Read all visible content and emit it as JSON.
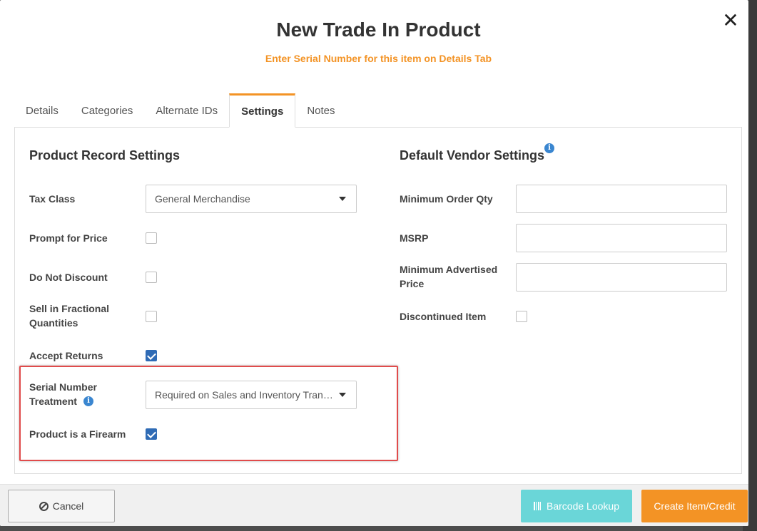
{
  "modal": {
    "title": "New Trade In Product",
    "subtitle": "Enter Serial Number for this item on Details Tab"
  },
  "tabs": [
    {
      "label": "Details",
      "active": false
    },
    {
      "label": "Categories",
      "active": false
    },
    {
      "label": "Alternate IDs",
      "active": false
    },
    {
      "label": "Settings",
      "active": true
    },
    {
      "label": "Notes",
      "active": false
    }
  ],
  "product_settings": {
    "title": "Product Record Settings",
    "tax_class": {
      "label": "Tax Class",
      "value": "General Merchandise"
    },
    "prompt_for_price": {
      "label": "Prompt for Price",
      "checked": false
    },
    "do_not_discount": {
      "label": "Do Not Discount",
      "checked": false
    },
    "sell_fractional": {
      "label": "Sell in Fractional Quantities",
      "checked": false
    },
    "accept_returns": {
      "label": "Accept Returns",
      "checked": true
    },
    "serial_number_treatment": {
      "label": "Serial Number Treatment",
      "value": "Required on Sales and Inventory Transactions"
    },
    "product_is_firearm": {
      "label": "Product is a Firearm",
      "checked": true
    }
  },
  "vendor_settings": {
    "title": "Default Vendor Settings",
    "minimum_order_qty": {
      "label": "Minimum Order Qty",
      "value": ""
    },
    "msrp": {
      "label": "MSRP",
      "value": ""
    },
    "minimum_advertised_price": {
      "label": "Minimum Advertised Price",
      "value": ""
    },
    "discontinued_item": {
      "label": "Discontinued Item",
      "checked": false
    }
  },
  "footer": {
    "cancel_label": "Cancel",
    "barcode_label": "Barcode Lookup",
    "create_label": "Create Item/Credit"
  },
  "colors": {
    "accent": "#f39325",
    "checkbox_checked": "#2f6bb5",
    "barcode_button": "#6ad6d8",
    "highlight": "#e04b4b",
    "info_icon": "#3a86d0"
  },
  "icons": {
    "close": "close-icon",
    "info": "info-icon",
    "cancel": "ban-icon",
    "barcode": "barcode-icon"
  }
}
